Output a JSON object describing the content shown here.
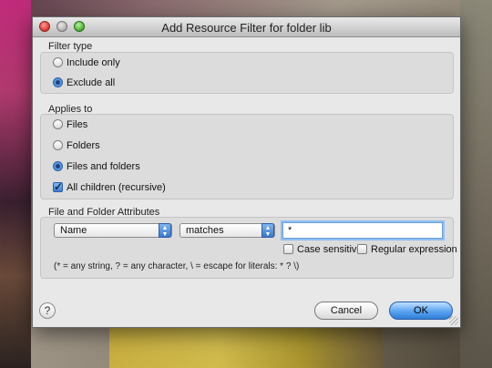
{
  "window": {
    "title": "Add Resource Filter for folder lib"
  },
  "filter_type": {
    "label": "Filter type",
    "options": [
      {
        "label": "Include only",
        "selected": false
      },
      {
        "label": "Exclude all",
        "selected": true
      }
    ]
  },
  "applies_to": {
    "label": "Applies to",
    "options": [
      {
        "label": "Files",
        "selected": false
      },
      {
        "label": "Folders",
        "selected": false
      },
      {
        "label": "Files and folders",
        "selected": true
      }
    ],
    "recursive": {
      "label": "All children (recursive)",
      "checked": true
    }
  },
  "attributes": {
    "label": "File and Folder Attributes",
    "attribute_select": "Name",
    "operator_select": "matches",
    "pattern_value": "*",
    "case_sensitive": {
      "label": "Case sensitive",
      "checked": false
    },
    "regex": {
      "label": "Regular expression",
      "checked": false
    },
    "hint": "(* = any string, ? = any character, \\ = escape for literals: * ? \\)"
  },
  "buttons": {
    "help": "?",
    "cancel": "Cancel",
    "ok": "OK"
  }
}
